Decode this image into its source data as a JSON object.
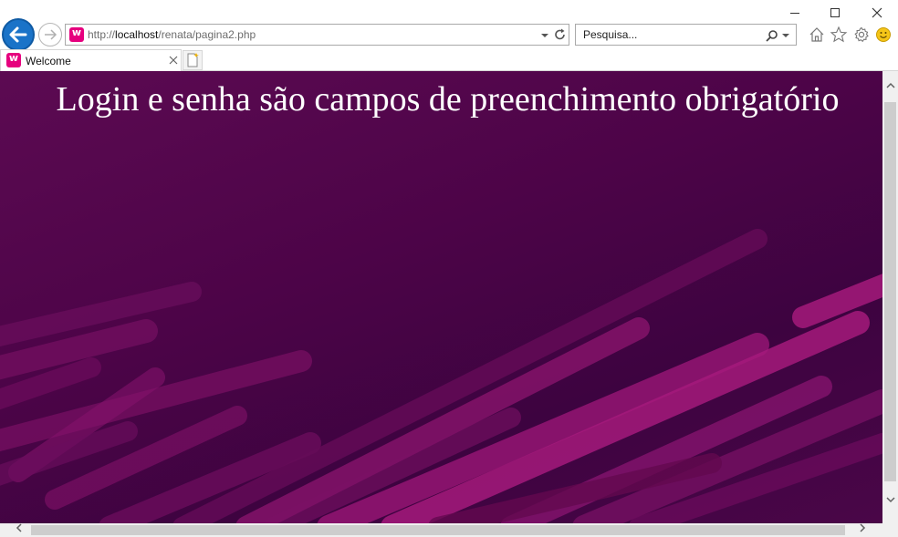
{
  "browser": {
    "address_bar": {
      "url_scheme": "http://",
      "url_host": "localhost",
      "url_path": "/renata/pagina2.php"
    },
    "search": {
      "placeholder": "Pesquisa..."
    },
    "tabs": [
      {
        "label": "Welcome",
        "active": true
      }
    ],
    "icons": {
      "back": "back-arrow-icon",
      "forward": "forward-arrow-icon",
      "home": "home-icon",
      "favorites": "star-icon",
      "settings": "gear-icon",
      "feedback": "smiley-icon",
      "refresh": "refresh-icon",
      "search": "search-icon"
    },
    "colors": {
      "page_bg": "#4d0448",
      "stripe_accent": "#b0186e",
      "back_button": "#1a73c8"
    }
  },
  "page": {
    "heading": "Login e senha são campos de preenchimento obrigatório"
  }
}
